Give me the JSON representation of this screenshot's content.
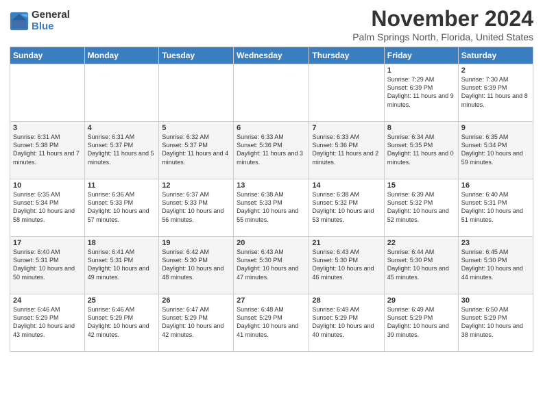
{
  "logo": {
    "general": "General",
    "blue": "Blue"
  },
  "title": "November 2024",
  "location": "Palm Springs North, Florida, United States",
  "days_of_week": [
    "Sunday",
    "Monday",
    "Tuesday",
    "Wednesday",
    "Thursday",
    "Friday",
    "Saturday"
  ],
  "weeks": [
    [
      {
        "day": "",
        "info": ""
      },
      {
        "day": "",
        "info": ""
      },
      {
        "day": "",
        "info": ""
      },
      {
        "day": "",
        "info": ""
      },
      {
        "day": "",
        "info": ""
      },
      {
        "day": "1",
        "info": "Sunrise: 7:29 AM\nSunset: 6:39 PM\nDaylight: 11 hours and 9 minutes."
      },
      {
        "day": "2",
        "info": "Sunrise: 7:30 AM\nSunset: 6:39 PM\nDaylight: 11 hours and 8 minutes."
      }
    ],
    [
      {
        "day": "3",
        "info": "Sunrise: 6:31 AM\nSunset: 5:38 PM\nDaylight: 11 hours and 7 minutes."
      },
      {
        "day": "4",
        "info": "Sunrise: 6:31 AM\nSunset: 5:37 PM\nDaylight: 11 hours and 5 minutes."
      },
      {
        "day": "5",
        "info": "Sunrise: 6:32 AM\nSunset: 5:37 PM\nDaylight: 11 hours and 4 minutes."
      },
      {
        "day": "6",
        "info": "Sunrise: 6:33 AM\nSunset: 5:36 PM\nDaylight: 11 hours and 3 minutes."
      },
      {
        "day": "7",
        "info": "Sunrise: 6:33 AM\nSunset: 5:36 PM\nDaylight: 11 hours and 2 minutes."
      },
      {
        "day": "8",
        "info": "Sunrise: 6:34 AM\nSunset: 5:35 PM\nDaylight: 11 hours and 0 minutes."
      },
      {
        "day": "9",
        "info": "Sunrise: 6:35 AM\nSunset: 5:34 PM\nDaylight: 10 hours and 59 minutes."
      }
    ],
    [
      {
        "day": "10",
        "info": "Sunrise: 6:35 AM\nSunset: 5:34 PM\nDaylight: 10 hours and 58 minutes."
      },
      {
        "day": "11",
        "info": "Sunrise: 6:36 AM\nSunset: 5:33 PM\nDaylight: 10 hours and 57 minutes."
      },
      {
        "day": "12",
        "info": "Sunrise: 6:37 AM\nSunset: 5:33 PM\nDaylight: 10 hours and 56 minutes."
      },
      {
        "day": "13",
        "info": "Sunrise: 6:38 AM\nSunset: 5:33 PM\nDaylight: 10 hours and 55 minutes."
      },
      {
        "day": "14",
        "info": "Sunrise: 6:38 AM\nSunset: 5:32 PM\nDaylight: 10 hours and 53 minutes."
      },
      {
        "day": "15",
        "info": "Sunrise: 6:39 AM\nSunset: 5:32 PM\nDaylight: 10 hours and 52 minutes."
      },
      {
        "day": "16",
        "info": "Sunrise: 6:40 AM\nSunset: 5:31 PM\nDaylight: 10 hours and 51 minutes."
      }
    ],
    [
      {
        "day": "17",
        "info": "Sunrise: 6:40 AM\nSunset: 5:31 PM\nDaylight: 10 hours and 50 minutes."
      },
      {
        "day": "18",
        "info": "Sunrise: 6:41 AM\nSunset: 5:31 PM\nDaylight: 10 hours and 49 minutes."
      },
      {
        "day": "19",
        "info": "Sunrise: 6:42 AM\nSunset: 5:30 PM\nDaylight: 10 hours and 48 minutes."
      },
      {
        "day": "20",
        "info": "Sunrise: 6:43 AM\nSunset: 5:30 PM\nDaylight: 10 hours and 47 minutes."
      },
      {
        "day": "21",
        "info": "Sunrise: 6:43 AM\nSunset: 5:30 PM\nDaylight: 10 hours and 46 minutes."
      },
      {
        "day": "22",
        "info": "Sunrise: 6:44 AM\nSunset: 5:30 PM\nDaylight: 10 hours and 45 minutes."
      },
      {
        "day": "23",
        "info": "Sunrise: 6:45 AM\nSunset: 5:30 PM\nDaylight: 10 hours and 44 minutes."
      }
    ],
    [
      {
        "day": "24",
        "info": "Sunrise: 6:46 AM\nSunset: 5:29 PM\nDaylight: 10 hours and 43 minutes."
      },
      {
        "day": "25",
        "info": "Sunrise: 6:46 AM\nSunset: 5:29 PM\nDaylight: 10 hours and 42 minutes."
      },
      {
        "day": "26",
        "info": "Sunrise: 6:47 AM\nSunset: 5:29 PM\nDaylight: 10 hours and 42 minutes."
      },
      {
        "day": "27",
        "info": "Sunrise: 6:48 AM\nSunset: 5:29 PM\nDaylight: 10 hours and 41 minutes."
      },
      {
        "day": "28",
        "info": "Sunrise: 6:49 AM\nSunset: 5:29 PM\nDaylight: 10 hours and 40 minutes."
      },
      {
        "day": "29",
        "info": "Sunrise: 6:49 AM\nSunset: 5:29 PM\nDaylight: 10 hours and 39 minutes."
      },
      {
        "day": "30",
        "info": "Sunrise: 6:50 AM\nSunset: 5:29 PM\nDaylight: 10 hours and 38 minutes."
      }
    ]
  ]
}
